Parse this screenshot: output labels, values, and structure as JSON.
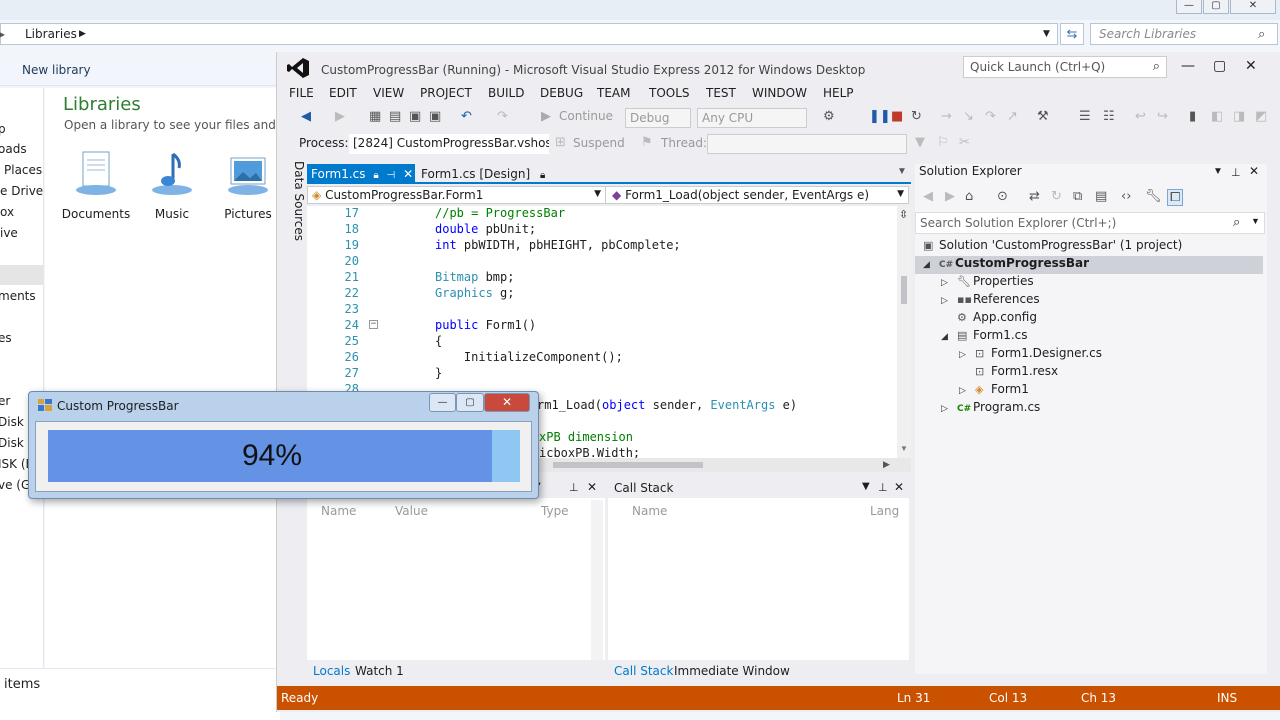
{
  "explorer": {
    "address_crumb": "Libraries",
    "search_placeholder": "Search Libraries",
    "toolbar_new_library": "New library",
    "nav_items": [
      "",
      "p",
      "oads",
      "Places",
      "e Drive",
      "ox",
      "ive",
      "ments",
      "es",
      "er",
      "Disk (C",
      "Disk (E",
      "ISK (E",
      "ve (G"
    ],
    "libraries_title": "Libraries",
    "libraries_subtitle": "Open a library to see your files and arran",
    "library_items": [
      "Documents",
      "Music",
      "Pictures"
    ],
    "status_items": "items"
  },
  "vs": {
    "title": "CustomProgressBar (Running) - Microsoft Visual Studio Express 2012 for Windows Desktop",
    "quick_launch_placeholder": "Quick Launch (Ctrl+Q)",
    "menu": [
      "FILE",
      "EDIT",
      "VIEW",
      "PROJECT",
      "BUILD",
      "DEBUG",
      "TEAM",
      "TOOLS",
      "TEST",
      "WINDOW",
      "HELP"
    ],
    "toolbar": {
      "continue_label": "Continue",
      "config_combo": "Debug",
      "platform_combo": "Any CPU"
    },
    "debug_location": {
      "process_label": "Process:",
      "process_value": "[2824] CustomProgressBar.vshost.",
      "suspend_label": "Suspend",
      "thread_label": "Thread:"
    },
    "data_sources_tab": "Data Sources",
    "doc_tabs": [
      "Form1.cs",
      "Form1.cs [Design]"
    ],
    "nav_bar": {
      "type_combo": "CustomProgressBar.Form1",
      "member_combo": "Form1_Load(object sender, EventArgs e)"
    },
    "code_lines": [
      {
        "n": "17",
        "text": "//pb = ProgressBar"
      },
      {
        "n": "18",
        "text": "double pbUnit;"
      },
      {
        "n": "19",
        "text": "int pbWIDTH, pbHEIGHT, pbComplete;"
      },
      {
        "n": "20",
        "text": ""
      },
      {
        "n": "21",
        "text": "Bitmap bmp;"
      },
      {
        "n": "22",
        "text": "Graphics g;"
      },
      {
        "n": "23",
        "text": ""
      },
      {
        "n": "24",
        "text": "public Form1()"
      },
      {
        "n": "25",
        "text": "{"
      },
      {
        "n": "26",
        "text": "    InitializeComponent();"
      },
      {
        "n": "27",
        "text": "}"
      },
      {
        "n": "28",
        "text": ""
      }
    ],
    "code_overflow": {
      "line29_tail": "rm1_Load(object sender, EventArgs e)",
      "line31_tail": "xPB dimension",
      "line32_tail": "icboxPB.Width;"
    },
    "locals_panel": {
      "columns": [
        "Name",
        "Value",
        "Type"
      ],
      "tabs": [
        "Locals",
        "Watch 1"
      ]
    },
    "callstack_panel": {
      "title": "Call Stack",
      "columns": [
        "Name",
        "Lang"
      ],
      "tabs": [
        "Call Stack",
        "Immediate Window"
      ]
    },
    "solution_explorer": {
      "title": "Solution Explorer",
      "search_placeholder": "Search Solution Explorer (Ctrl+;)",
      "nodes": [
        "Solution 'CustomProgressBar' (1 project)",
        "CustomProgressBar",
        "Properties",
        "References",
        "App.config",
        "Form1.cs",
        "Form1.Designer.cs",
        "Form1.resx",
        "Form1",
        "Program.cs"
      ]
    },
    "status": {
      "state": "Ready",
      "line": "Ln 31",
      "col": "Col 13",
      "ch": "Ch 13",
      "mode": "INS"
    },
    "accent_color": "#007acc",
    "status_color": "#ca5100"
  },
  "progress_window": {
    "title": "Custom ProgressBar",
    "percent_label": "94%",
    "progress_fraction": 0.94,
    "fill_color": "#6492e4",
    "track_color": "#8ec8f2"
  }
}
